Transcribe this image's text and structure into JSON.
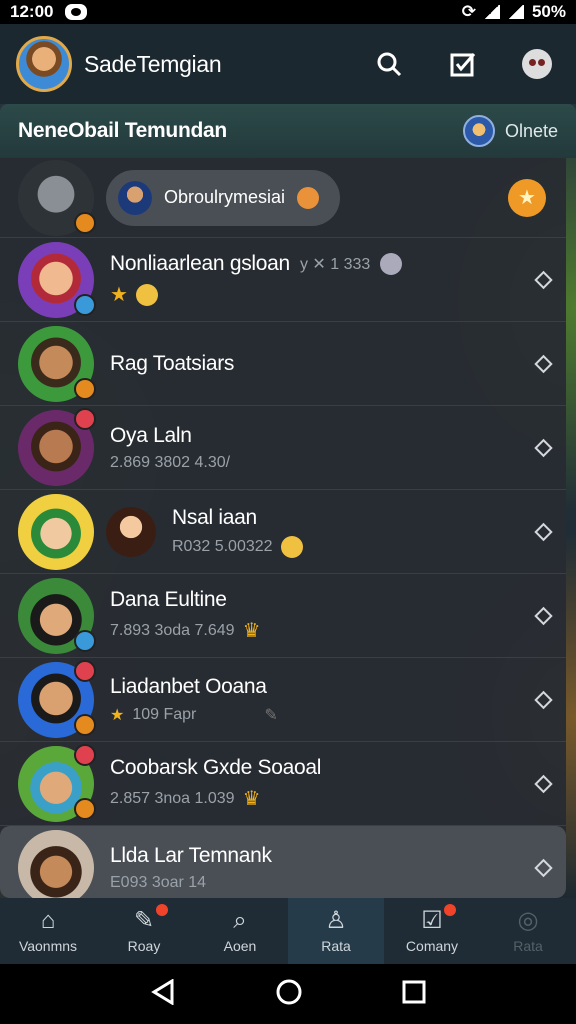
{
  "status_bar": {
    "time": "12:00",
    "battery": "50%"
  },
  "app_bar": {
    "title": "SadeTemgian"
  },
  "section": {
    "title": "NeneObail Temundan",
    "online_label": "Olnete"
  },
  "pinned": {
    "chip_text": "Obroulrymesiai"
  },
  "contacts": [
    {
      "name": "Nonliaarlean gsloan",
      "meta": "y ✕ 1 333",
      "badge": "blue"
    },
    {
      "name": "Rag Toatsiars",
      "meta": "",
      "badge": "orange"
    },
    {
      "name": "Oya Laln",
      "meta": "2.869   3802   4.30/",
      "badge": "red"
    },
    {
      "name": "Nsal iaan",
      "meta": "R032   5.00322",
      "badge": ""
    },
    {
      "name": "Dana Eultine",
      "meta": "7.893   3oda   7.649",
      "badge": "blue"
    },
    {
      "name": "Liadanbet Ooana",
      "meta": "109   Fapr",
      "badge": "red"
    },
    {
      "name": "Coobarsk Gxde Soaoal",
      "meta": "2.857   3noa   1.039",
      "badge": "red"
    },
    {
      "name": "Llda Lar Temnank",
      "meta": "E093   3oar   14",
      "badge": ""
    }
  ],
  "bottom_nav": [
    {
      "label": "Vaonmns",
      "icon": "home-icon"
    },
    {
      "label": "Roay",
      "icon": "edit-icon"
    },
    {
      "label": "Aoen",
      "icon": "search-icon"
    },
    {
      "label": "Rata",
      "icon": "person-icon"
    },
    {
      "label": "Comany",
      "icon": "check-badge-icon"
    },
    {
      "label": "Rata",
      "icon": "ring-icon"
    }
  ]
}
